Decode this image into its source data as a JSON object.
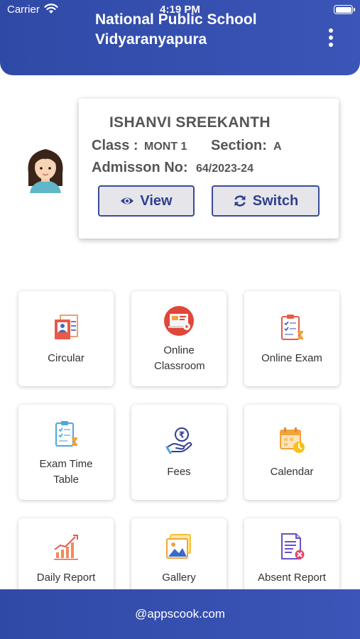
{
  "statusbar": {
    "carrier": "Carrier",
    "time": "4:19 PM"
  },
  "header": {
    "school_name": "National Public School Vidyaranyapura"
  },
  "student": {
    "name": "ISHANVI SREEKANTH",
    "class_label": "Class :",
    "class_value": "MONT 1",
    "section_label": "Section:",
    "section_value": "A",
    "admission_label": "Admisson No:",
    "admission_value": "64/2023-24",
    "view_label": "View",
    "switch_label": "Switch"
  },
  "tiles": [
    {
      "label": "Circular",
      "icon": "circular-icon"
    },
    {
      "label": "Online Classroom",
      "icon": "online-classroom-icon"
    },
    {
      "label": "Online Exam",
      "icon": "online-exam-icon"
    },
    {
      "label": "Exam Time Table",
      "icon": "exam-timetable-icon"
    },
    {
      "label": "Fees",
      "icon": "fees-icon"
    },
    {
      "label": "Calendar",
      "icon": "calendar-icon"
    },
    {
      "label": "Daily Report",
      "icon": "daily-report-icon"
    },
    {
      "label": "Gallery",
      "icon": "gallery-icon"
    },
    {
      "label": "Absent Report",
      "icon": "absent-report-icon"
    }
  ],
  "footer": {
    "text": "@appscook.com"
  },
  "colors": {
    "primary": "#3049a8",
    "button_text": "#2f3f8f"
  }
}
